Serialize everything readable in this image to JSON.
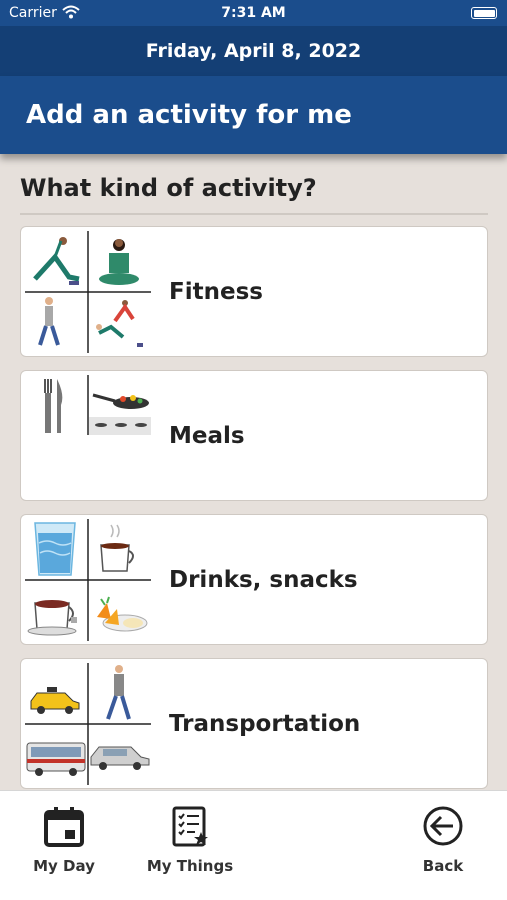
{
  "status_bar": {
    "carrier": "Carrier",
    "time": "7:31 AM"
  },
  "date_label": "Friday, April 8, 2022",
  "header": {
    "title": "Add an activity for me"
  },
  "question": "What kind of activity?",
  "activities": [
    {
      "label": "Fitness"
    },
    {
      "label": "Meals"
    },
    {
      "label": "Drinks, snacks"
    },
    {
      "label": "Transportation"
    }
  ],
  "tabs": [
    {
      "label": "My Day",
      "icon": "calendar-icon"
    },
    {
      "label": "My Things",
      "icon": "checklist-icon"
    },
    {
      "label": "Back",
      "icon": "back-arrow-icon"
    }
  ],
  "colors": {
    "header_blue": "#1b4d8c",
    "date_blue": "#143f75",
    "background": "#e6e0db"
  }
}
